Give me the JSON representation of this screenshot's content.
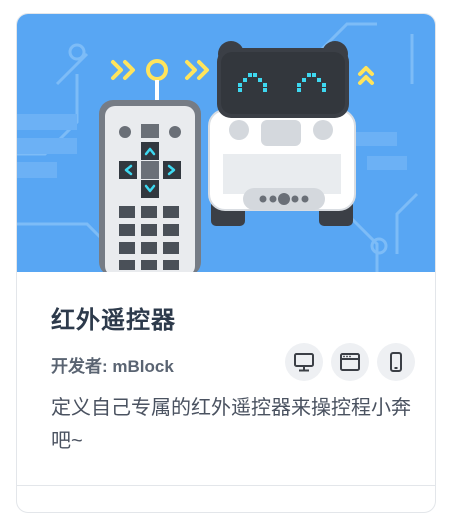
{
  "card": {
    "title": "红外遥控器",
    "developer": "开发者: mBlock",
    "description": "定义自己专属的红外遥控器来操控程小奔吧~",
    "platforms": [
      "desktop-icon",
      "browser-icon",
      "mobile-icon"
    ]
  },
  "colors": {
    "banner": "#58a6f3",
    "accent_yellow": "#ffe45c",
    "robot_eyes": "#3ed8f0",
    "title": "#2d3a4b",
    "platform_bg": "#eef0f3"
  }
}
